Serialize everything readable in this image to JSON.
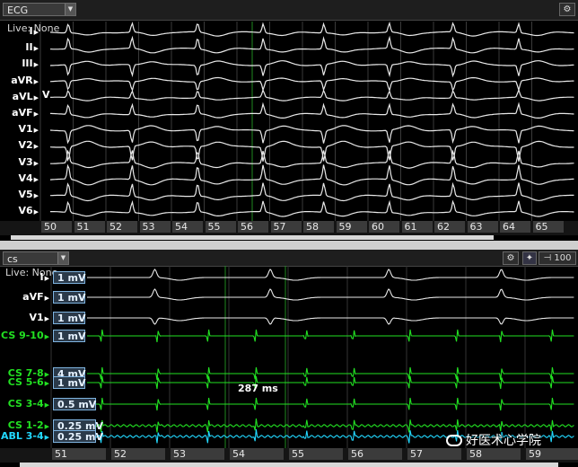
{
  "ecg": {
    "title": "ECG",
    "live_text": "Live: None",
    "leads": [
      "I",
      "II",
      "III",
      "aVR",
      "aVL",
      "aVF",
      "V1",
      "V2",
      "V3",
      "V4",
      "V5",
      "V6"
    ],
    "lead_suffix": "V",
    "ticks": [
      "50",
      "51",
      "52",
      "53",
      "54",
      "55",
      "56",
      "57",
      "58",
      "59",
      "60",
      "61",
      "62",
      "63",
      "64",
      "65"
    ],
    "beats_seconds": [
      50.85,
      52.8,
      54.8,
      56.8,
      58.65,
      60.65,
      62.6,
      64.6
    ]
  },
  "cs": {
    "title": "cs",
    "live_text": "Live: None",
    "zoom": "100",
    "leads": [
      {
        "label": "I",
        "scale": "1 mV",
        "color": "white"
      },
      {
        "label": "aVF",
        "scale": "1 mV",
        "color": "white"
      },
      {
        "label": "V1",
        "scale": "1 mV",
        "color": "white"
      },
      {
        "label": "CS 9-10",
        "scale": "1 mV",
        "color": "green"
      },
      {
        "label": "CS 7-8",
        "scale": "4 mV",
        "color": "green"
      },
      {
        "label": "CS 5-6",
        "scale": "1 mV",
        "color": "green"
      },
      {
        "label": "CS 3-4",
        "scale": "0.5 mV",
        "color": "green"
      },
      {
        "label": "CS 1-2",
        "scale": "0.25 mV",
        "color": "green"
      },
      {
        "label": "ABL 3-4",
        "scale": "0.25 mV",
        "color": "cyan"
      }
    ],
    "annotation": "287 ms",
    "ticks": [
      "51",
      "52",
      "53",
      "54",
      "55",
      "56",
      "57",
      "58",
      "59"
    ],
    "v_beats_seconds": [
      52.75,
      54.7,
      56.7,
      58.6
    ],
    "cs_beats_seconds": [
      51.85,
      52.8,
      53.65,
      54.45,
      55.3,
      56.1,
      57.05,
      57.85,
      58.6,
      59.45
    ]
  },
  "watermark": "好医术心学院",
  "colors": {
    "white_trace": "#e8e8e8",
    "green_trace": "#22e022",
    "cyan_trace": "#22d8ff",
    "background": "#000000"
  }
}
